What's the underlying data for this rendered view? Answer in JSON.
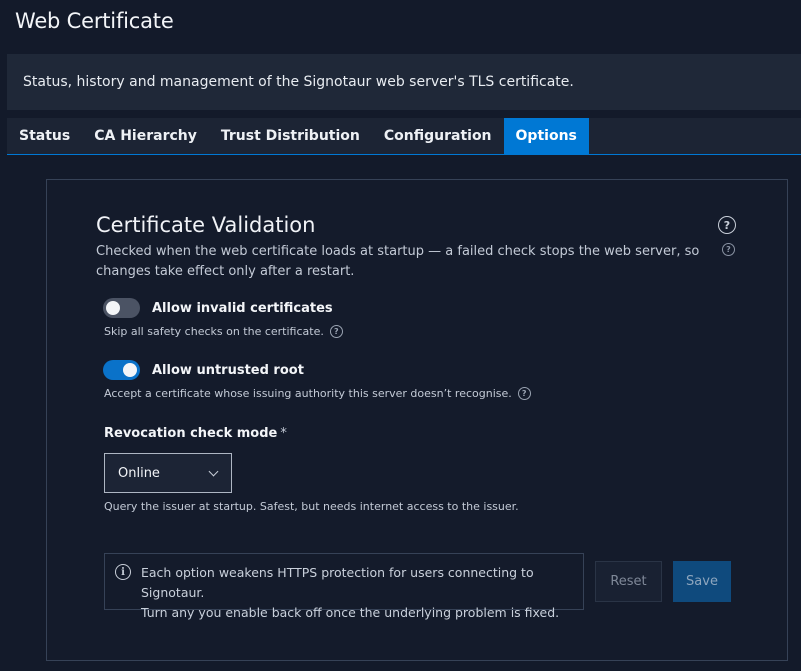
{
  "header": {
    "title": "Web Certificate",
    "subtitle": "Status, history and management of the Signotaur web server's TLS certificate."
  },
  "tabs": [
    {
      "label": "Status",
      "active": false
    },
    {
      "label": "CA Hierarchy",
      "active": false
    },
    {
      "label": "Trust Distribution",
      "active": false
    },
    {
      "label": "Configuration",
      "active": false
    },
    {
      "label": "Options",
      "active": true
    }
  ],
  "card": {
    "title": "Certificate Validation",
    "description": "Checked when the web certificate loads at startup — a failed check stops the web server, so changes take effect only after a restart.",
    "help_icon": "question-circle-icon",
    "options": [
      {
        "label": "Allow invalid certificates",
        "enabled": false,
        "hint": "Skip all safety checks on the certificate."
      },
      {
        "label": "Allow untrusted root",
        "enabled": true,
        "hint": "Accept a certificate whose issuing authority this server doesn’t recognise."
      }
    ],
    "revocation": {
      "label": "Revocation check mode",
      "required_mark": "*",
      "selected": "Online",
      "hint": "Query the issuer at startup. Safest, but needs internet access to the issuer."
    },
    "notice": {
      "icon": "info-circle-icon",
      "line1": "Each option weakens HTTPS protection for users connecting to Signotaur.",
      "line2": "Turn any you enable back off once the underlying problem is fixed."
    },
    "buttons": {
      "reset": "Reset",
      "save": "Save"
    }
  },
  "colors": {
    "accent": "#0078d4",
    "background": "#131a2a"
  }
}
